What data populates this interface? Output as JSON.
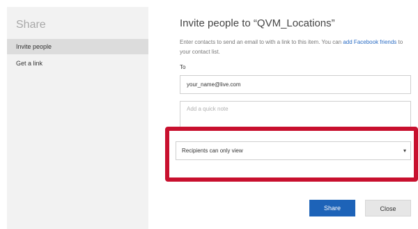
{
  "sidebar": {
    "title": "Share",
    "items": [
      {
        "label": "Invite people",
        "selected": true
      },
      {
        "label": "Get a link",
        "selected": false
      }
    ]
  },
  "main": {
    "title": "Invite people to “QVM_Locations”",
    "description_prefix": "Enter contacts to send an email to with a link to this item. You can ",
    "description_link": "add Facebook friends",
    "description_suffix": " to your contact list.",
    "to_label": "To",
    "to_value": "your_name@live.com",
    "note_placeholder": "Add a quick note",
    "permission_selected": "Recipients can only view",
    "permission_arrow": "▾"
  },
  "buttons": {
    "share_label": "Share",
    "close_label": "Close"
  },
  "colors": {
    "accent": "#1d63b8",
    "highlight": "#c8102e",
    "link": "#2a6cc4",
    "sidebar_bg": "#f2f2f2"
  }
}
